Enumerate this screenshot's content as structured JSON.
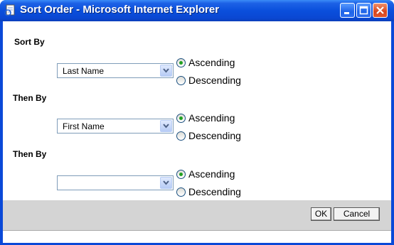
{
  "window": {
    "title": "Sort Order - Microsoft Internet Explorer"
  },
  "sections": [
    {
      "label": "Sort By",
      "select_value": "Last Name",
      "options": [
        "Ascending",
        "Descending"
      ],
      "selected": "Ascending"
    },
    {
      "label": "Then By",
      "select_value": "First Name",
      "options": [
        "Ascending",
        "Descending"
      ],
      "selected": "Ascending"
    },
    {
      "label": "Then By",
      "select_value": "",
      "options": [
        "Ascending",
        "Descending"
      ],
      "selected": "Ascending"
    }
  ],
  "buttons": {
    "ok": "OK",
    "cancel": "Cancel"
  },
  "icons": {
    "app": "ie-page-icon",
    "minimize": "minimize-icon",
    "maximize": "maximize-icon",
    "close": "close-icon",
    "dropdown": "chevron-down-icon"
  },
  "colors": {
    "titlebar": "#0a4fdc",
    "close_button": "#d8461e",
    "radio_dot": "#21a121",
    "footer": "#d4d4d4"
  }
}
